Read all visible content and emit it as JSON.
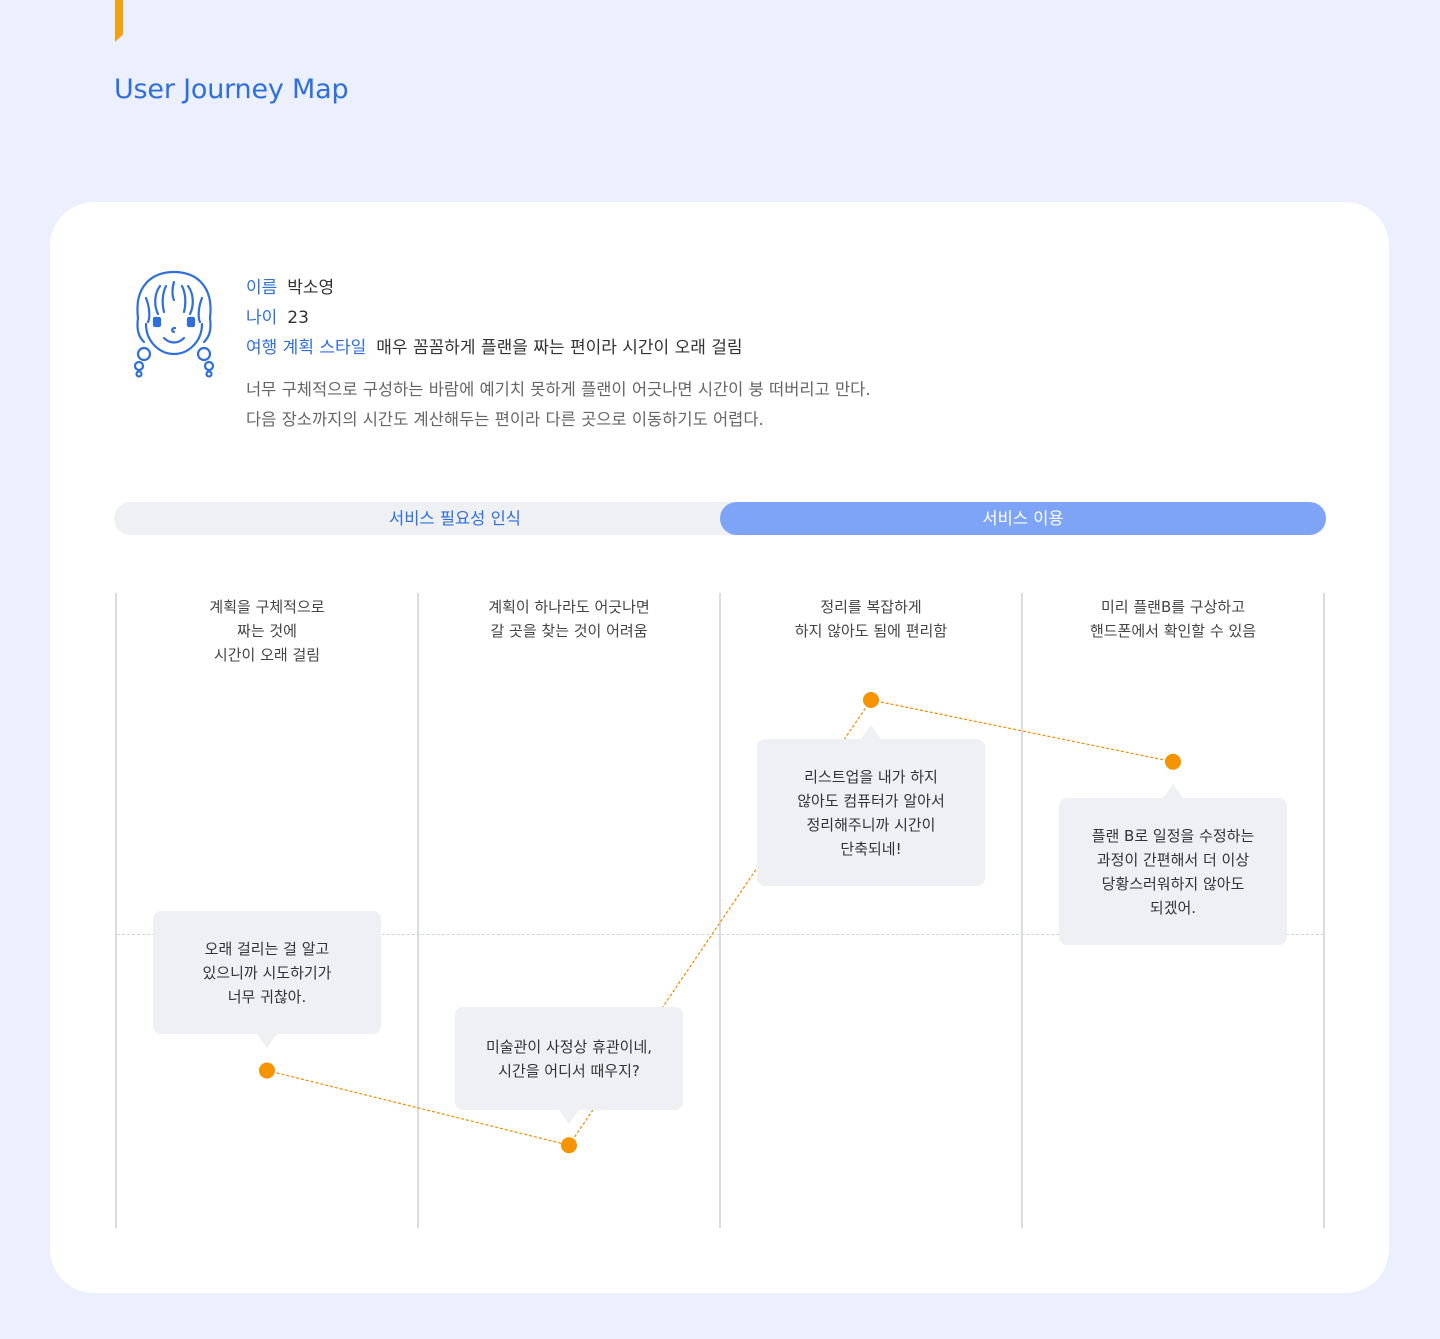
{
  "page": {
    "title": "User Journey Map"
  },
  "persona": {
    "avatar_icon": "girl-avatar-icon",
    "rows": [
      {
        "label": "이름",
        "value": "박소영"
      },
      {
        "label": "나이",
        "value": "23"
      },
      {
        "label": "여행 계획 스타일",
        "value": "매우 꼼꼼하게 플랜을 짜는 편이라 시간이 오래 걸림"
      }
    ],
    "description": [
      "너무 구체적으로 구성하는 바람에 예기치 못하게 플랜이 어긋나면 시간이 붕 떠버리고 만다.",
      "다음 장소까지의 시간도 계산해두는 편이라 다른 곳으로 이동하기도 어렵다."
    ]
  },
  "stages": [
    {
      "label": "서비스 필요성 인식",
      "active": false
    },
    {
      "label": "서비스 이용",
      "active": true
    }
  ],
  "columns": [
    {
      "header": [
        "계획을 구체적으로",
        "짜는 것에",
        "시간이 오래 걸림"
      ]
    },
    {
      "header": [
        "계획이 하나라도 어긋나면",
        "갈 곳을 찾는 것이 어려움"
      ]
    },
    {
      "header": [
        "정리를 복잡하게",
        "하지 않아도 됨에 편리함"
      ]
    },
    {
      "header": [
        "미리 플랜B를 구상하고",
        "핸드폰에서 확인할 수 있음"
      ]
    }
  ],
  "chart_data": {
    "type": "line",
    "categories": [
      "계획을 구체적으로 짜는 것에 시간이 오래 걸림",
      "계획이 하나라도 어긋나면 갈 곳을 찾는 것이 어려움",
      "정리를 복잡하게 하지 않아도 됨에 편리함",
      "미리 플랜B를 구상하고 핸드폰에서 확인할 수 있음"
    ],
    "series": [
      {
        "values": [
          -0.42,
          -0.65,
          0.72,
          0.53
        ]
      }
    ],
    "ylim": [
      -1,
      1
    ],
    "baseline": 0,
    "colors": {
      "line": "#F08C00",
      "point": "#F59300"
    }
  },
  "comments": [
    [
      "오래 걸리는 걸 알고",
      "있으니까 시도하기가",
      "너무 귀찮아."
    ],
    [
      "미술관이 사정상 휴관이네,",
      "시간을 어디서 때우지?"
    ],
    [
      "리스트업을 내가 하지",
      "않아도 컴퓨터가 알아서",
      "정리해주니까 시간이",
      "단축되네!"
    ],
    [
      "플랜 B로 일정을 수정하는",
      "과정이 간편해서 더 이상",
      "당황스러워하지 않아도",
      "되겠어."
    ]
  ],
  "colors": {
    "background": "#ECEFFD",
    "card": "#FFFFFF",
    "accent": "#F5A10E",
    "brand": "#2F6FDB",
    "stage_active": "#7EA4F8",
    "bubble": "#EEF0F4"
  }
}
